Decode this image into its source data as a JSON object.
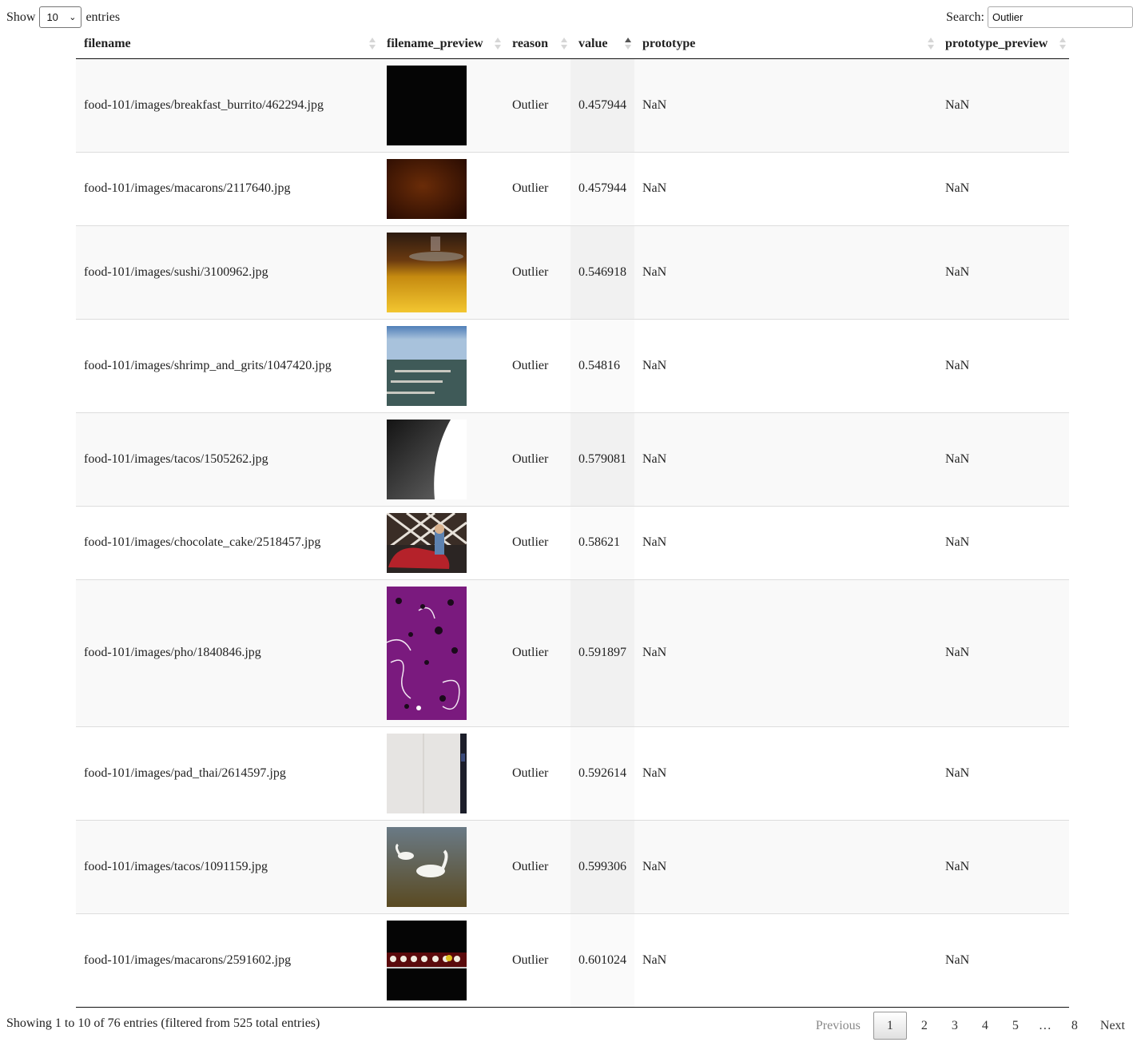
{
  "length_menu": {
    "show_label": "Show",
    "entries_label": "entries",
    "selected_value": "10"
  },
  "search": {
    "label": "Search:",
    "value": "Outlier"
  },
  "columns": [
    "filename",
    "filename_preview",
    "reason",
    "value",
    "prototype",
    "prototype_preview"
  ],
  "rows": [
    {
      "filename": "food-101/images/breakfast_burrito/462294.jpg",
      "reason": "Outlier",
      "value": "0.457944",
      "prototype": "NaN",
      "prototype_preview": "NaN"
    },
    {
      "filename": "food-101/images/macarons/2117640.jpg",
      "reason": "Outlier",
      "value": "0.457944",
      "prototype": "NaN",
      "prototype_preview": "NaN"
    },
    {
      "filename": "food-101/images/sushi/3100962.jpg",
      "reason": "Outlier",
      "value": "0.546918",
      "prototype": "NaN",
      "prototype_preview": "NaN"
    },
    {
      "filename": "food-101/images/shrimp_and_grits/1047420.jpg",
      "reason": "Outlier",
      "value": "0.54816",
      "prototype": "NaN",
      "prototype_preview": "NaN"
    },
    {
      "filename": "food-101/images/tacos/1505262.jpg",
      "reason": "Outlier",
      "value": "0.579081",
      "prototype": "NaN",
      "prototype_preview": "NaN"
    },
    {
      "filename": "food-101/images/chocolate_cake/2518457.jpg",
      "reason": "Outlier",
      "value": "0.58621",
      "prototype": "NaN",
      "prototype_preview": "NaN"
    },
    {
      "filename": "food-101/images/pho/1840846.jpg",
      "reason": "Outlier",
      "value": "0.591897",
      "prototype": "NaN",
      "prototype_preview": "NaN"
    },
    {
      "filename": "food-101/images/pad_thai/2614597.jpg",
      "reason": "Outlier",
      "value": "0.592614",
      "prototype": "NaN",
      "prototype_preview": "NaN"
    },
    {
      "filename": "food-101/images/tacos/1091159.jpg",
      "reason": "Outlier",
      "value": "0.599306",
      "prototype": "NaN",
      "prototype_preview": "NaN"
    },
    {
      "filename": "food-101/images/macarons/2591602.jpg",
      "reason": "Outlier",
      "value": "0.601024",
      "prototype": "NaN",
      "prototype_preview": "NaN"
    }
  ],
  "info_text": "Showing 1 to 10 of 76 entries (filtered from 525 total entries)",
  "pagination": {
    "previous": "Previous",
    "pages": [
      "1",
      "2",
      "3",
      "4",
      "5"
    ],
    "ellipsis": "…",
    "last_page": "8",
    "next": "Next",
    "current": "1"
  }
}
